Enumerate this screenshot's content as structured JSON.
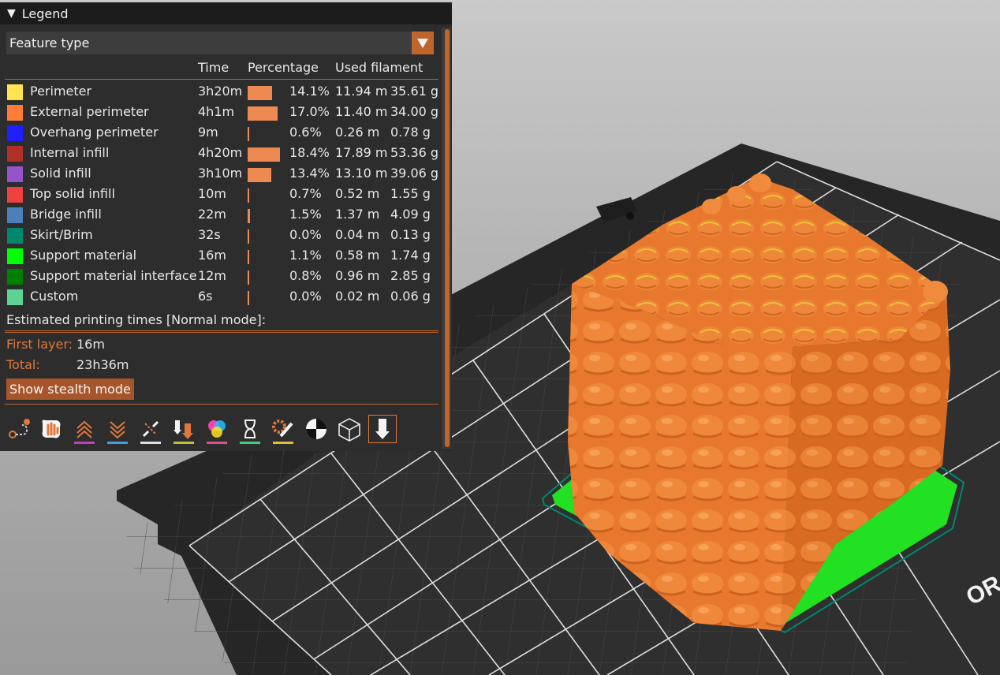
{
  "legend": {
    "title": "Legend",
    "view_type": "Feature type",
    "columns": {
      "time": "Time",
      "percentage": "Percentage",
      "used_filament": "Used filament"
    },
    "rows": [
      {
        "name": "Perimeter",
        "color": "#ffe44f",
        "time": "3h20m",
        "percent": "14.1%",
        "pct": 14.1,
        "length": "11.94 m",
        "weight": "35.61 g"
      },
      {
        "name": "External perimeter",
        "color": "#ff7d38",
        "time": "4h1m",
        "percent": "17.0%",
        "pct": 17.0,
        "length": "11.40 m",
        "weight": "34.00 g"
      },
      {
        "name": "Overhang perimeter",
        "color": "#1f1fff",
        "time": "9m",
        "percent": "0.6%",
        "pct": 0.6,
        "length": "0.26 m",
        "weight": "0.78 g"
      },
      {
        "name": "Internal infill",
        "color": "#b03029",
        "time": "4h20m",
        "percent": "18.4%",
        "pct": 18.4,
        "length": "17.89 m",
        "weight": "53.36 g"
      },
      {
        "name": "Solid infill",
        "color": "#9654cc",
        "time": "3h10m",
        "percent": "13.4%",
        "pct": 13.4,
        "length": "13.10 m",
        "weight": "39.06 g"
      },
      {
        "name": "Top solid infill",
        "color": "#f04040",
        "time": "10m",
        "percent": "0.7%",
        "pct": 0.7,
        "length": "0.52 m",
        "weight": "1.55 g"
      },
      {
        "name": "Bridge infill",
        "color": "#4d80ba",
        "time": "22m",
        "percent": "1.5%",
        "pct": 1.5,
        "length": "1.37 m",
        "weight": "4.09 g"
      },
      {
        "name": "Skirt/Brim",
        "color": "#00876e",
        "time": "32s",
        "percent": "0.0%",
        "pct": 0.0,
        "length": "0.04 m",
        "weight": "0.13 g"
      },
      {
        "name": "Support material",
        "color": "#00ff00",
        "time": "16m",
        "percent": "1.1%",
        "pct": 1.1,
        "length": "0.58 m",
        "weight": "1.74 g"
      },
      {
        "name": "Support material interface",
        "color": "#008000",
        "time": "12m",
        "percent": "0.8%",
        "pct": 0.8,
        "length": "0.96 m",
        "weight": "2.85 g"
      },
      {
        "name": "Custom",
        "color": "#5ed194",
        "time": "6s",
        "percent": "0.0%",
        "pct": 0.0,
        "length": "0.02 m",
        "weight": "0.06 g"
      }
    ],
    "estimate_title": "Estimated printing times [Normal mode]:",
    "first_layer_label": "First layer:",
    "first_layer_value": "16m",
    "total_label": "Total:",
    "total_value": "23h36m",
    "stealth_button": "Show stealth mode",
    "toolbar": [
      {
        "icon": "travel-icon",
        "underline": ""
      },
      {
        "icon": "wipe-icon",
        "underline": ""
      },
      {
        "icon": "retractions-icon",
        "underline": "#c040c0"
      },
      {
        "icon": "deretractions-icon",
        "underline": "#40a0e0"
      },
      {
        "icon": "seams-icon",
        "underline": "#e0e0e0"
      },
      {
        "icon": "tool-changes-icon",
        "underline": "#c0c040"
      },
      {
        "icon": "color-changes-icon",
        "underline": "#e05090"
      },
      {
        "icon": "pause-prints-icon",
        "underline": "#40d080"
      },
      {
        "icon": "custom-gcodes-icon",
        "underline": "#e0c030"
      },
      {
        "icon": "center-of-gravity-icon",
        "underline": ""
      },
      {
        "icon": "shells-icon",
        "underline": ""
      },
      {
        "icon": "tool-marker-icon",
        "underline": ""
      }
    ]
  },
  "bed": {
    "logo_text": "OR"
  },
  "colors": {
    "accent": "#c0652b",
    "panel_bg": "#2d2d2d",
    "model": "#e8782d",
    "support": "#22e022"
  }
}
